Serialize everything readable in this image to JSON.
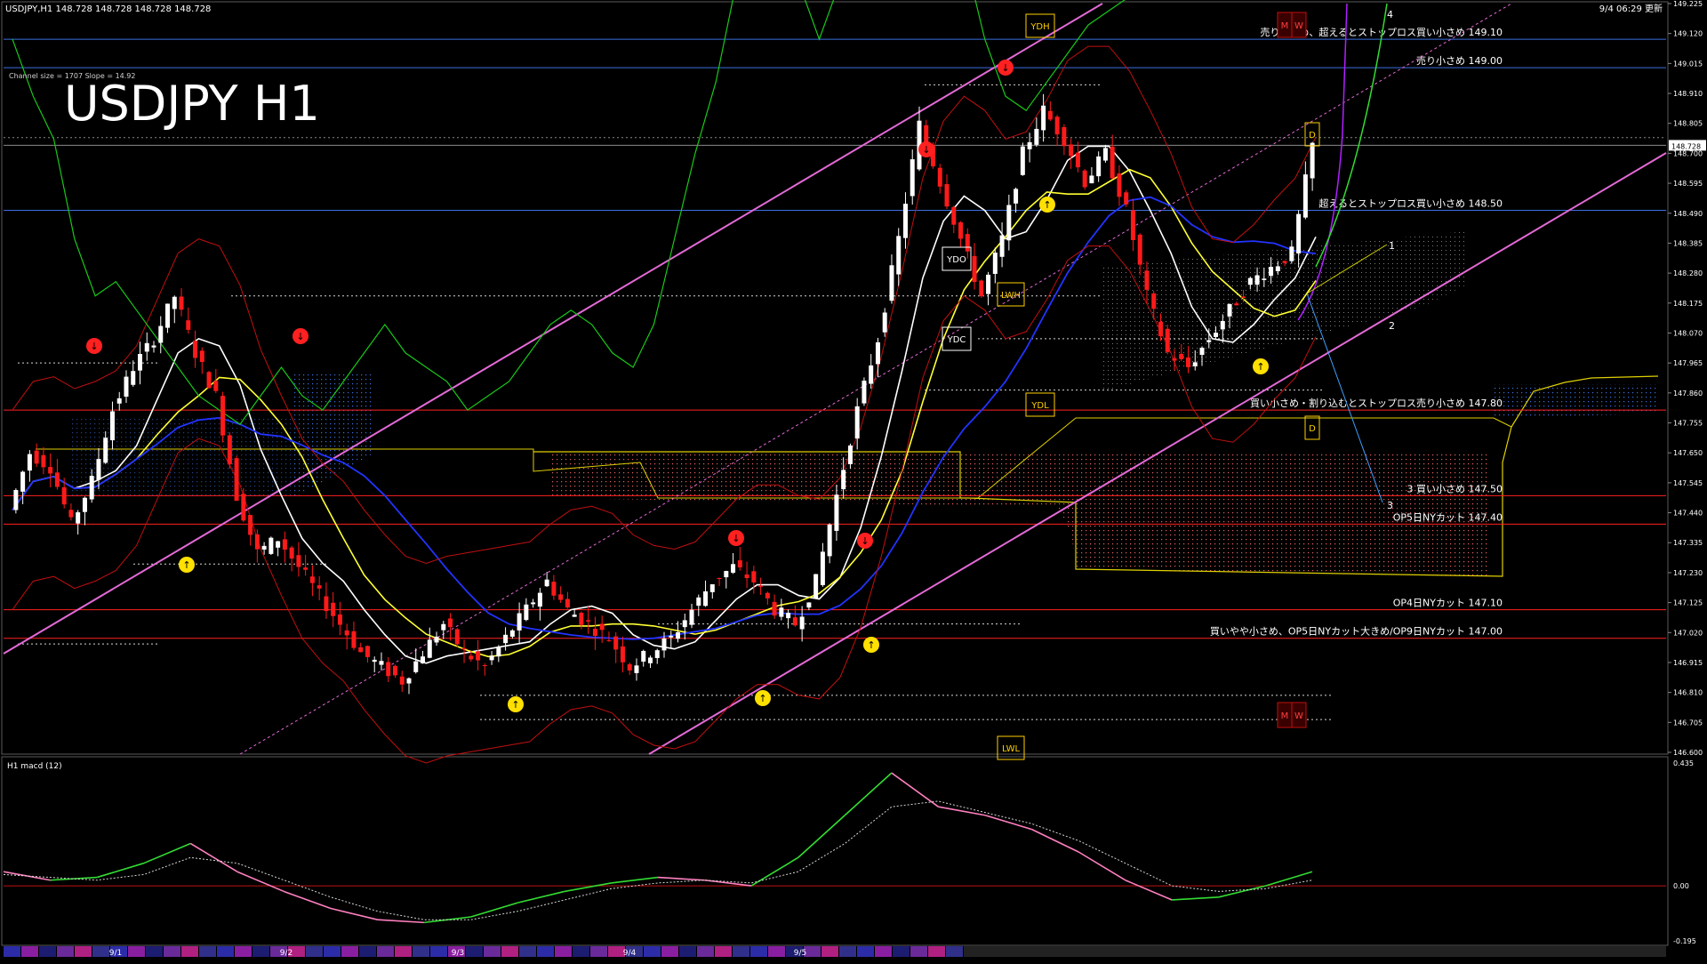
{
  "header": {
    "symbol_line": "USDJPY,H1  148.728 148.728 148.728 148.728",
    "timestamp": "9/4 06:29 更新",
    "channel_info": "Channel size = 1707 Slope = 14.92",
    "big_title": "USDJPY H1"
  },
  "macd_label": "H1 macd (12)",
  "chart_data": [
    {
      "type": "line",
      "title": "USDJPY H1",
      "ylim": [
        146.6,
        149.225
      ],
      "yticks": [
        "149.225",
        "149.120",
        "149.015",
        "148.910",
        "148.805",
        "148.700",
        "148.595",
        "148.490",
        "148.385",
        "148.280",
        "148.175",
        "148.070",
        "147.965",
        "147.860",
        "147.755",
        "147.650",
        "147.545",
        "147.440",
        "147.335",
        "147.230",
        "147.125",
        "147.020",
        "146.915",
        "146.810",
        "146.705",
        "146.600"
      ],
      "current_price": "148.728",
      "close_path": [
        147.45,
        147.65,
        147.6,
        147.4,
        147.55,
        147.8,
        147.95,
        148.05,
        148.2,
        148.0,
        147.85,
        147.5,
        147.3,
        147.35,
        147.25,
        147.15,
        147.05,
        146.95,
        146.9,
        146.85,
        146.95,
        147.05,
        146.95,
        146.9,
        147.0,
        147.1,
        147.2,
        147.1,
        147.05,
        147.0,
        146.9,
        146.95,
        147.0,
        147.1,
        147.2,
        147.25,
        147.2,
        147.1,
        147.05,
        147.2,
        147.5,
        147.8,
        148.05,
        148.4,
        148.8,
        148.6,
        148.4,
        148.2,
        148.4,
        148.7,
        148.85,
        148.75,
        148.6,
        148.7,
        148.5,
        148.2,
        148.0,
        147.95,
        148.05,
        148.15,
        148.25,
        148.3,
        148.35,
        148.728
      ],
      "levels": [
        {
          "price": 149.1,
          "label": "売り小さめ、超えるとストップロス買い小さめ 149.10"
        },
        {
          "price": 149.0,
          "label": "売り小さめ 149.00"
        },
        {
          "price": 148.5,
          "label": "超えるとストップロス買い小さめ 148.50"
        },
        {
          "price": 147.8,
          "label": "買い小さめ・割り込むとストップロス売り小さめ 147.80"
        },
        {
          "price": 147.5,
          "label": "3  買い小さめ 147.50"
        },
        {
          "price": 147.4,
          "label": "OP5日NYカット 147.40"
        },
        {
          "price": 147.1,
          "label": "OP4日NYカット 147.10"
        },
        {
          "price": 147.0,
          "label": "買いやや小さめ、OP5日NYカット大きめ/OP9日NYカット 147.00"
        }
      ],
      "markers": [
        "YDH",
        "YDO",
        "YDC",
        "YDL",
        "LWH",
        "LWL",
        "D",
        "M",
        "W"
      ],
      "wave_labels": [
        "1",
        "2",
        "3",
        "4"
      ],
      "dates": [
        "9/1",
        "9/2",
        "9/3",
        "9/4",
        "9/5"
      ]
    },
    {
      "type": "line",
      "title": "H1 macd (12)",
      "ylim": [
        -0.195,
        0.435
      ],
      "yticks": [
        "0.435",
        "0.00",
        "-0.195"
      ],
      "macd": [
        0.05,
        0.02,
        0.03,
        0.08,
        0.15,
        0.05,
        -0.02,
        -0.08,
        -0.12,
        -0.13,
        -0.11,
        -0.06,
        -0.02,
        0.01,
        0.03,
        0.02,
        0.0,
        0.1,
        0.25,
        0.4,
        0.28,
        0.25,
        0.2,
        0.12,
        0.02,
        -0.05,
        -0.04,
        0.0,
        0.05
      ],
      "signal": [
        0.04,
        0.03,
        0.02,
        0.04,
        0.1,
        0.08,
        0.02,
        -0.04,
        -0.09,
        -0.12,
        -0.12,
        -0.09,
        -0.05,
        -0.01,
        0.01,
        0.02,
        0.01,
        0.05,
        0.15,
        0.28,
        0.3,
        0.26,
        0.22,
        0.16,
        0.08,
        0.0,
        -0.02,
        -0.01,
        0.02
      ]
    }
  ],
  "colors": {
    "level": "#ff2020",
    "blue_level": "#3b6fe0",
    "channel": "#e36ad6",
    "kumo": "#ff6a6a",
    "ema_white": "#ffffff",
    "ema_yellow": "#ffff33",
    "ema_blue": "#2233ff",
    "bb": "#c01010",
    "chikou": "#19c819",
    "bull": "#ffffff",
    "bear": "#ff1a1a",
    "macd": "#33dd33"
  }
}
